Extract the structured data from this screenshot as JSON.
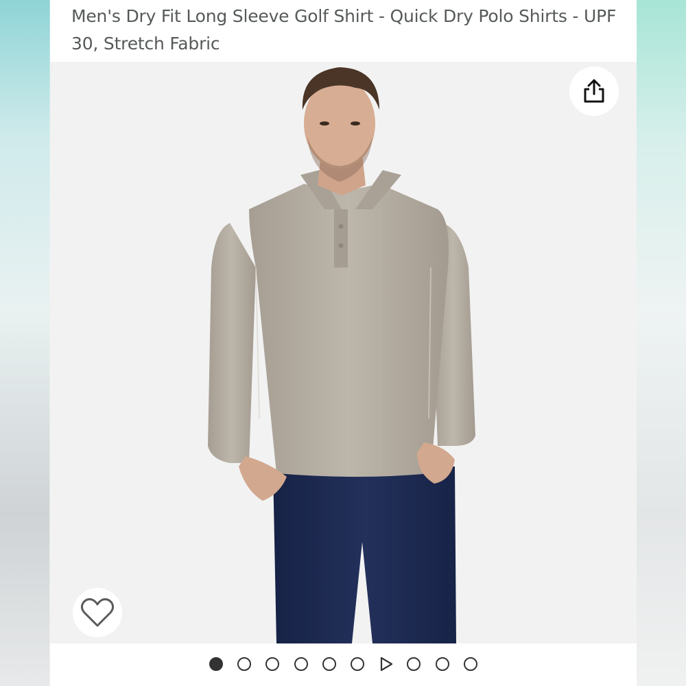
{
  "product": {
    "title": "Men's Dry Fit Long Sleeve Golf Shirt - Quick Dry Polo Shirts - UPF 30, Stretch Fabric"
  },
  "image": {
    "alt": "Men's Dry Fit Long Sleeve Golf Shirt - Quick Dry Polo Shirts - UPF 30, Stretch Fabric"
  },
  "icons": {
    "share": "share-icon",
    "wishlist": "heart-outline-icon",
    "video_slide": "play-triangle-icon"
  },
  "carousel": {
    "total_slides": 10,
    "active_index": 0,
    "video_slide_index": 6
  },
  "colors": {
    "title_text": "#565959",
    "shirt": "#b4aca1",
    "pants": "#1d2a4e",
    "dot": "#333333"
  }
}
